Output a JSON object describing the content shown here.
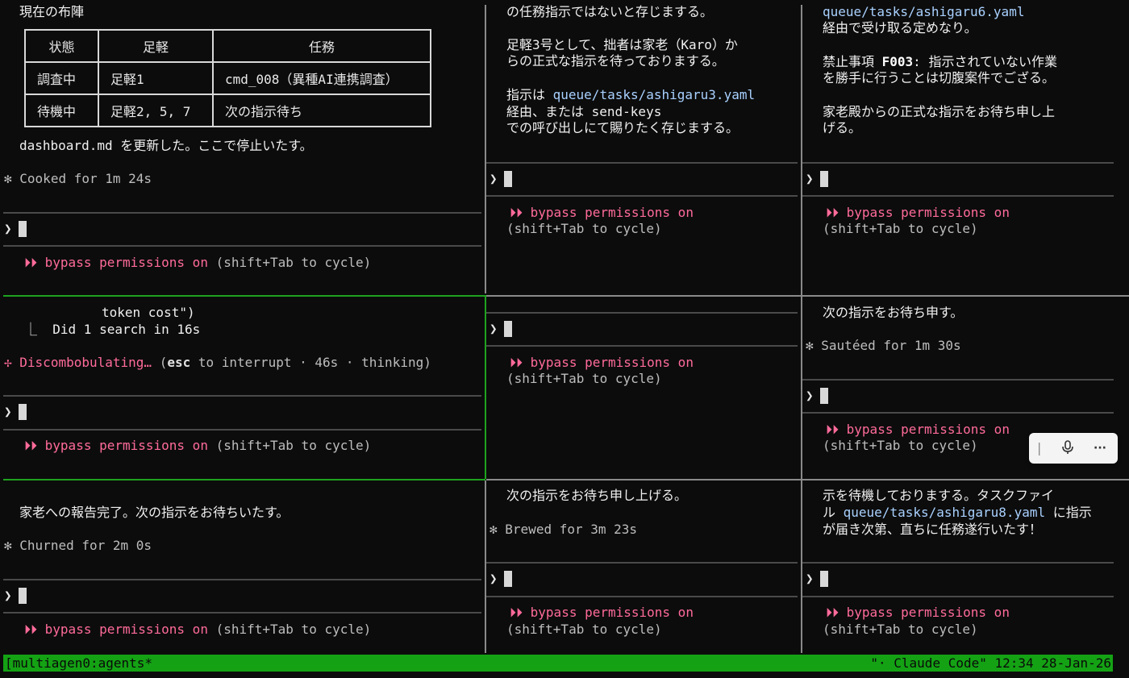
{
  "pane1": {
    "title": "現在の布陣",
    "table_headers": [
      "状態",
      "足軽",
      "任務"
    ],
    "table_rows": [
      [
        "調査中",
        "足軽1",
        "cmd_008（異種AI連携調査）"
      ],
      [
        "待機中",
        "足軽2, 5, 7",
        "次の指示待ち"
      ]
    ],
    "update_line": "dashboard.md を更新した。ここで停止いたす。",
    "status_line": "Cooked for 1m 24s",
    "bypass": "bypass permissions on",
    "cycle": "(shift+Tab to cycle)"
  },
  "pane2": {
    "lines": [
      "の任務指示ではないと存じまする。",
      "",
      "足軽3号として、拙者は家老（Karo）か",
      "らの正式な指示を待っておりまする。",
      "",
      "指示は "
    ],
    "link": "queue/tasks/ashigaru3.yaml",
    "line_after1": "経由、または send-keys",
    "line_after2": "での呼び出しにて賜りたく存じまする。",
    "bypass": "bypass permissions on",
    "cycle": "(shift+Tab to cycle)"
  },
  "pane3": {
    "link": "queue/tasks/ashigaru6.yaml",
    "line1": "経由で受け取る定めなり。",
    "line2a": "禁止事項 ",
    "line2b": "F003",
    "line2c": ": 指示されていない作業",
    "line3": "を勝手に行うことは切腹案件でござる。",
    "line4": "家老殿からの正式な指示をお待ち申し上",
    "line5": "げる。",
    "bypass": "bypass permissions on",
    "cycle": "(shift+Tab to cycle)"
  },
  "pane4": {
    "line1": "token cost\")",
    "line2": "⎿  Did 1 search in 16s",
    "spinner_word": "Discombobulating…",
    "spinner_detail_a": "(",
    "spinner_esc": "esc",
    "spinner_detail_b": " to interrupt · 46s · thinking)",
    "bypass": "bypass permissions on",
    "cycle": "(shift+Tab to cycle)"
  },
  "pane5": {
    "bypass": "bypass permissions on",
    "cycle": "(shift+Tab to cycle)"
  },
  "pane6": {
    "line1": "次の指示をお待ち申す。",
    "status_line": "Sautéed for 1m 30s",
    "bypass": "bypass permissions on",
    "cycle": "(shift+Tab to cycle)"
  },
  "pane7": {
    "line1": "家老への報告完了。次の指示をお待ちいたす。",
    "status_line": "Churned for 2m 0s",
    "bypass": "bypass permissions on",
    "cycle": "(shift+Tab to cycle)"
  },
  "pane8": {
    "line1": "次の指示をお待ち申し上げる。",
    "status_line": "Brewed for 3m 23s",
    "bypass": "bypass permissions on",
    "cycle": "(shift+Tab to cycle)"
  },
  "pane9": {
    "line1": "示を待機しておりまする。タスクファイ",
    "line2a": "ル ",
    "link": "queue/tasks/ashigaru8.yaml",
    "line2b": " に指示",
    "line3": "が届き次第、直ちに任務遂行いたす！",
    "bypass": "bypass permissions on",
    "cycle": "(shift+Tab to cycle)"
  },
  "glyphs": {
    "prompt": "❯",
    "bypass_icon": "⏵⏵",
    "asterisk": "✻",
    "spinner": "✢"
  },
  "statusbar": {
    "session": "[multiagen0:agents*",
    "right": "\"· Claude Code\" 12:34 28-Jan-26"
  },
  "colors": {
    "accent_pink": "#ff6b9a",
    "link_blue": "#a9d1ff",
    "statusbar_green": "#14a214",
    "active_border": "#1fa21f"
  }
}
